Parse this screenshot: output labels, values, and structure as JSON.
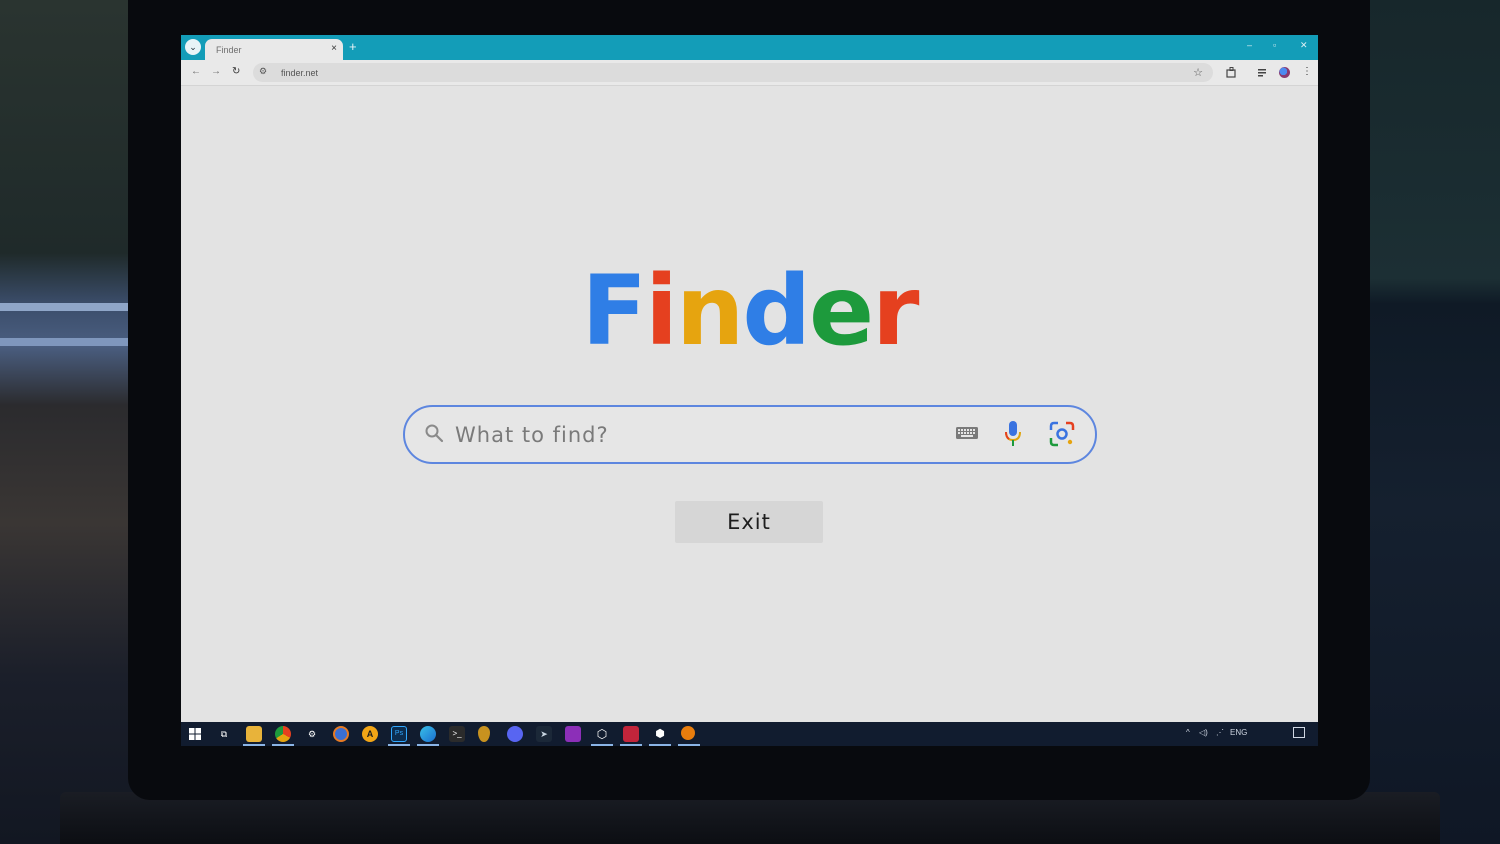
{
  "browser": {
    "tab_title": "Finder",
    "tab_close": "×",
    "new_tab": "+",
    "url": "finder.net",
    "window_controls": {
      "minimize": "–",
      "maximize": "▫",
      "close": "✕"
    },
    "nav_icons": {
      "back": "←",
      "forward": "→",
      "reload": "↻"
    }
  },
  "page": {
    "logo_letters": [
      "F",
      "i",
      "n",
      "d",
      "e",
      "r"
    ],
    "logo_colors": [
      "#2f7ee6",
      "#e5401f",
      "#e6a40f",
      "#2f7ee6",
      "#1d9a3c",
      "#e5401f"
    ],
    "search": {
      "placeholder": "What to find?",
      "value": ""
    },
    "exit_label": "Exit",
    "icons": [
      "search-icon",
      "keyboard-icon",
      "microphone-icon",
      "lens-icon"
    ]
  },
  "taskbar": {
    "apps": [
      "start",
      "task-view",
      "file-explorer",
      "chrome",
      "network",
      "firefox",
      "avast",
      "photoshop",
      "edge",
      "terminal",
      "security",
      "discord",
      "steam",
      "visual-studio",
      "unity",
      "game",
      "settings",
      "blender"
    ],
    "tray": {
      "language": "ENG"
    }
  },
  "colors": {
    "tabbar": "#139db8",
    "accent_border": "#5d86df",
    "page_background": "#e3e3e3",
    "taskbar": "#111c2f"
  }
}
